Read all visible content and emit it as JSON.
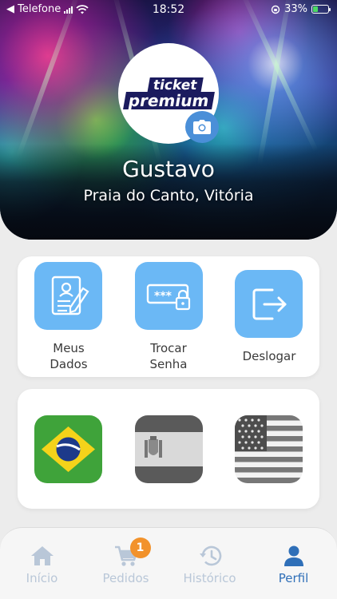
{
  "status_bar": {
    "carrier": "◀ Telefone",
    "time": "18:52",
    "battery": "33%",
    "battery_level": 0.33
  },
  "profile": {
    "logo_line1": "ticket",
    "logo_line2": "premium",
    "name": "Gustavo",
    "location": "Praia do Canto, Vitória"
  },
  "actions": [
    {
      "id": "meus-dados",
      "label": "Meus\nDados",
      "icon": "profile-form-icon"
    },
    {
      "id": "trocar-senha",
      "label": "Trocar\nSenha",
      "icon": "password-lock-icon"
    },
    {
      "id": "deslogar",
      "label": "Deslogar",
      "icon": "logout-icon"
    }
  ],
  "languages": [
    {
      "id": "brazil",
      "icon": "brazil-flag-icon",
      "selected": true
    },
    {
      "id": "spain",
      "icon": "spain-flag-icon",
      "selected": false
    },
    {
      "id": "usa",
      "icon": "usa-flag-icon",
      "selected": false
    }
  ],
  "tab_bar": {
    "items": [
      {
        "label": "Início",
        "icon": "home-icon",
        "active": false
      },
      {
        "label": "Pedidos",
        "icon": "cart-icon",
        "active": false,
        "badge": "1"
      },
      {
        "label": "Histórico",
        "icon": "history-icon",
        "active": false
      },
      {
        "label": "Perfil",
        "icon": "user-icon",
        "active": true
      }
    ]
  },
  "colors": {
    "accent": "#2f6fb8",
    "tile": "#6bb8f5",
    "badge": "#f2922b",
    "inactive_tab": "#b9c7d8"
  }
}
